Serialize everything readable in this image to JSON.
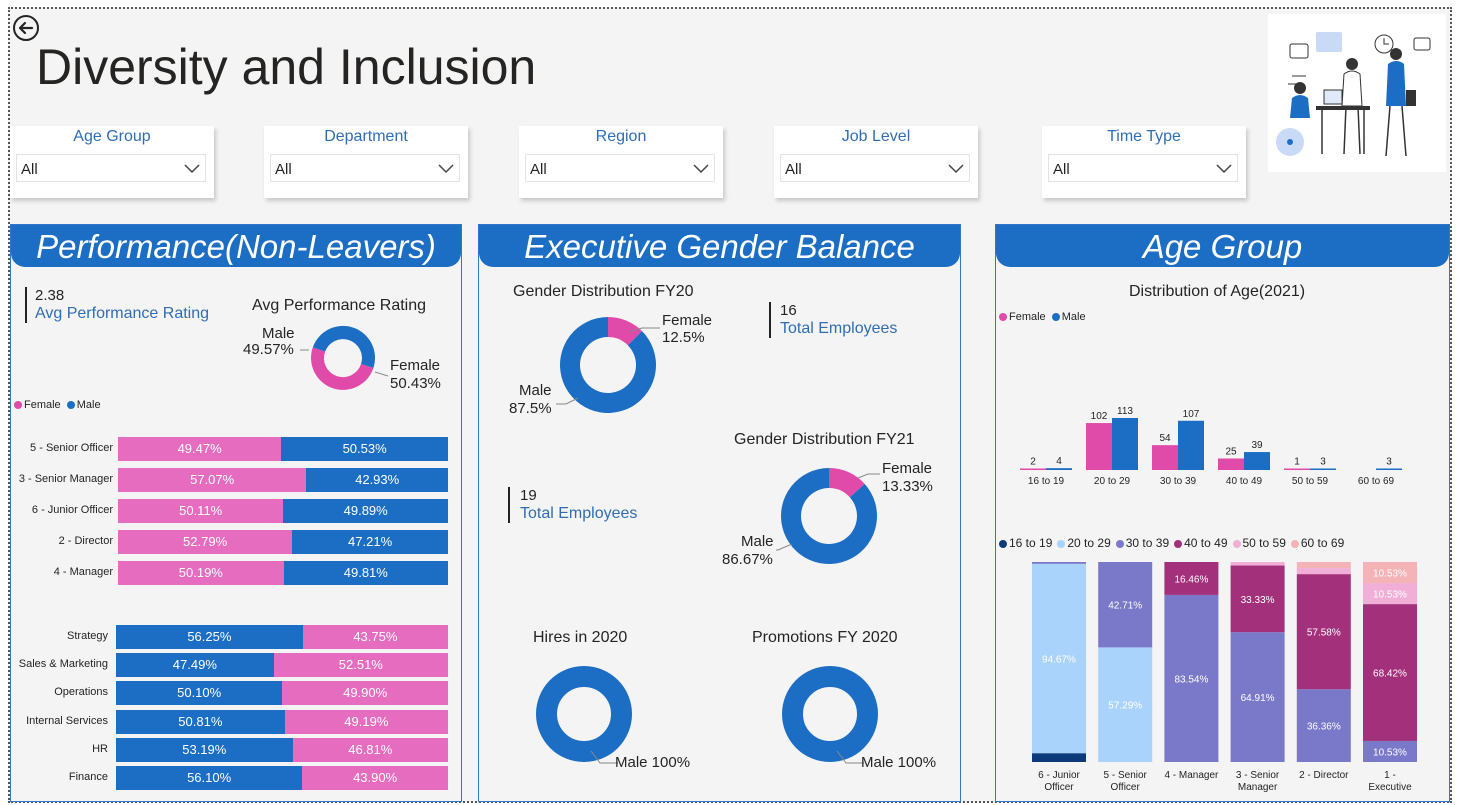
{
  "title": "Diversity and Inclusion",
  "colors": {
    "female": "#e66cbf",
    "male": "#1b6ec4",
    "accent": "#1b6ec4",
    "label_blue": "#2f6db5"
  },
  "slicers": [
    {
      "label": "Age Group",
      "value": "All"
    },
    {
      "label": "Department",
      "value": "All"
    },
    {
      "label": "Region",
      "value": "All"
    },
    {
      "label": "Job Level",
      "value": "All"
    },
    {
      "label": "Time Type",
      "value": "All"
    }
  ],
  "performance": {
    "header": "Performance(Non-Leavers)",
    "kpi": {
      "value": "2.38",
      "label": "Avg Performance Rating"
    },
    "donut": {
      "title": "Avg Performance Rating",
      "male_label": "Male",
      "male_pct": "49.57%",
      "female_label": "Female",
      "female_pct": "50.43%",
      "male_value": 49.57,
      "female_value": 50.43
    },
    "legend": {
      "female": "Female",
      "male": "Male"
    }
  },
  "executive": {
    "header": "Executive Gender Balance",
    "fy20": {
      "title": "Gender Distribution FY20",
      "female_label": "Female",
      "female_pct": "12.5%",
      "male_label": "Male",
      "male_pct": "87.5%",
      "female_value": 12.5,
      "male_value": 87.5,
      "kpi_value": "16",
      "kpi_label": "Total Employees"
    },
    "fy21": {
      "title": "Gender Distribution FY21",
      "female_label": "Female",
      "female_pct": "13.33%",
      "male_label": "Male",
      "male_pct": "86.67%",
      "female_value": 13.33,
      "male_value": 86.67,
      "kpi_value": "19",
      "kpi_label": "Total Employees"
    },
    "hires": {
      "title": "Hires in 2020",
      "label": "Male 100%",
      "male_value": 100
    },
    "promotions": {
      "title": "Promotions FY 2020",
      "label": "Male 100%",
      "male_value": 100
    }
  },
  "age": {
    "header": "Age Group",
    "chart_title": "Distribution of Age(2021)",
    "legend_gender": {
      "female": "Female",
      "male": "Male"
    },
    "stack_colors": [
      "#0d3b7a",
      "#a9d3fb",
      "#7a79c9",
      "#a3307a",
      "#f1afd8",
      "#f4b3b7"
    ]
  },
  "chart_data": [
    {
      "type": "bar",
      "orientation": "horizontal-stacked-100",
      "categories": [
        "5 - Senior Officer",
        "3 - Senior Manager",
        "6 - Junior Officer",
        "2 - Director",
        "4 - Manager"
      ],
      "series": [
        {
          "name": "Female",
          "values": [
            49.47,
            57.07,
            50.11,
            52.79,
            50.19
          ],
          "labels": [
            "49.47%",
            "57.07%",
            "50.11%",
            "52.79%",
            "50.19%"
          ]
        },
        {
          "name": "Male",
          "values": [
            50.53,
            42.93,
            49.89,
            47.21,
            49.81
          ],
          "labels": [
            "50.53%",
            "42.93%",
            "49.89%",
            "47.21%",
            "49.81%"
          ]
        }
      ]
    },
    {
      "type": "bar",
      "orientation": "horizontal-stacked-100",
      "categories": [
        "Strategy",
        "Sales & Marketing",
        "Operations",
        "Internal Services",
        "HR",
        "Finance"
      ],
      "series": [
        {
          "name": "Male",
          "values": [
            56.25,
            47.49,
            50.1,
            50.81,
            53.19,
            56.1
          ],
          "labels": [
            "56.25%",
            "47.49%",
            "50.10%",
            "50.81%",
            "53.19%",
            "56.10%"
          ]
        },
        {
          "name": "Female",
          "values": [
            43.75,
            52.51,
            49.9,
            49.19,
            46.81,
            43.9
          ],
          "labels": [
            "43.75%",
            "52.51%",
            "49.90%",
            "49.19%",
            "46.81%",
            "43.90%"
          ]
        }
      ]
    },
    {
      "type": "bar",
      "title": "Distribution of Age(2021)",
      "categories": [
        "16 to 19",
        "20 to 29",
        "30 to 39",
        "40 to 49",
        "50 to 59",
        "60 to 69"
      ],
      "series": [
        {
          "name": "Female",
          "values": [
            2,
            102,
            54,
            25,
            1,
            0
          ],
          "labels": [
            "2",
            "102",
            "54",
            "25",
            "1",
            ""
          ]
        },
        {
          "name": "Male",
          "values": [
            4,
            113,
            107,
            39,
            3,
            3
          ],
          "labels": [
            "4",
            "113",
            "107",
            "39",
            "3",
            "3"
          ]
        }
      ],
      "ylim": [
        0,
        113
      ]
    },
    {
      "type": "bar",
      "orientation": "vertical-stacked-100",
      "categories": [
        "6 - Junior Officer",
        "5 - Senior Officer",
        "4 - Manager",
        "3 - Senior Manager",
        "2 - Director",
        "1 - Executive"
      ],
      "series": [
        {
          "name": "16 to 19",
          "values": [
            4.4,
            0,
            0,
            0,
            0,
            0
          ],
          "labels": [
            "",
            "",
            "",
            "",
            "",
            ""
          ]
        },
        {
          "name": "20 to 29",
          "values": [
            94.67,
            57.29,
            0,
            0,
            0,
            0
          ],
          "labels": [
            "94.67%",
            "57.29%",
            "",
            "",
            "",
            ""
          ]
        },
        {
          "name": "30 to 39",
          "values": [
            0.93,
            42.71,
            83.54,
            64.91,
            36.36,
            10.53
          ],
          "labels": [
            "",
            "42.71%",
            "83.54%",
            "64.91%",
            "36.36%",
            "10.53%"
          ]
        },
        {
          "name": "40 to 49",
          "values": [
            0,
            0,
            16.46,
            33.33,
            57.58,
            68.42
          ],
          "labels": [
            "",
            "",
            "16.46%",
            "33.33%",
            "57.58%",
            "68.42%"
          ]
        },
        {
          "name": "50 to 59",
          "values": [
            0,
            0,
            0,
            1.76,
            3.03,
            10.53
          ],
          "labels": [
            "",
            "",
            "",
            "",
            "",
            "10.53%"
          ]
        },
        {
          "name": "60 to 69",
          "values": [
            0,
            0,
            0,
            0,
            3.03,
            10.53
          ],
          "labels": [
            "",
            "",
            "",
            "",
            "",
            "10.53%"
          ]
        }
      ],
      "ylim": [
        0,
        100
      ]
    }
  ]
}
